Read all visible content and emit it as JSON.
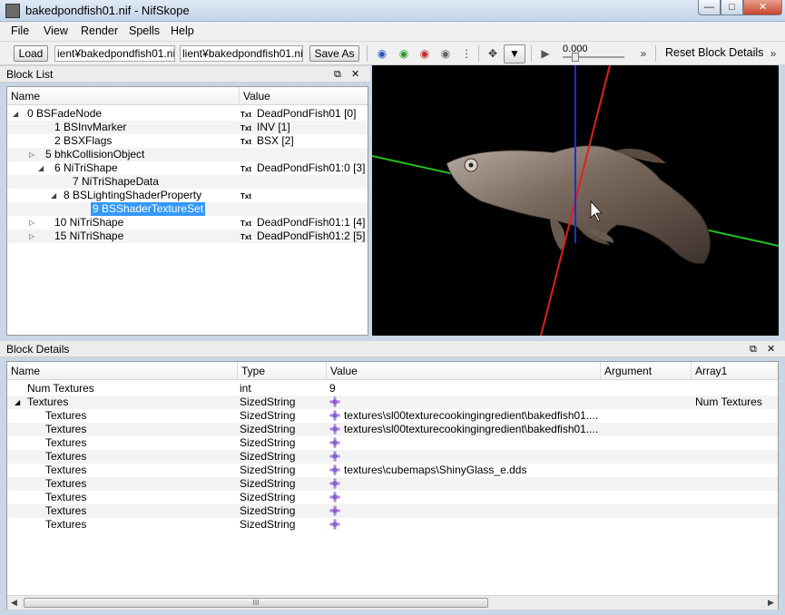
{
  "window": {
    "title": "bakedpondfish01.nif - NifSkope"
  },
  "menu": [
    "File",
    "View",
    "Render",
    "Spells",
    "Help"
  ],
  "toolbar": {
    "load_label": "Load",
    "load_path": "‎ient¥bakedpondfish01.nif",
    "save_path": "lient¥bakedpondfish01.nif",
    "save_label": "Save As",
    "time_value": "0.000",
    "reset_label": "Reset Block Details",
    "more_label": "»"
  },
  "block_list": {
    "title": "Block List",
    "columns": [
      "Name",
      "Value"
    ],
    "rows": [
      {
        "label": "0 BSFadeNode",
        "value": "DeadPondFish01 [0]",
        "expander": "open",
        "txt": true
      },
      {
        "label": "1 BSInvMarker",
        "value": "INV [1]",
        "expander": "",
        "txt": true
      },
      {
        "label": "2 BSXFlags",
        "value": "BSX [2]",
        "expander": "",
        "txt": true
      },
      {
        "label": "5 bhkCollisionObject",
        "value": "",
        "expander": "closed",
        "txt": false
      },
      {
        "label": "6 NiTriShape",
        "value": "DeadPondFish01:0 [3]",
        "expander": "open",
        "txt": true
      },
      {
        "label": "7 NiTriShapeData",
        "value": "",
        "expander": "",
        "txt": false
      },
      {
        "label": "8 BSLightingShaderProperty",
        "value": "",
        "expander": "open",
        "txt": true
      },
      {
        "label": "9 BSShaderTextureSet",
        "value": "",
        "expander": "",
        "txt": false
      },
      {
        "label": "10 NiTriShape",
        "value": "DeadPondFish01:1 [4]",
        "expander": "closed",
        "txt": true
      },
      {
        "label": "15 NiTriShape",
        "value": "DeadPondFish01:2 [5]",
        "expander": "closed",
        "txt": true
      }
    ],
    "txt_badge": "Txt"
  },
  "block_details": {
    "title": "Block Details",
    "columns": [
      "Name",
      "Type",
      "Value",
      "Argument",
      "Array1"
    ],
    "rows": [
      {
        "name": "Num Textures",
        "type": "int",
        "value": "9",
        "array1": "",
        "gem": false
      },
      {
        "name": "Textures",
        "type": "SizedString",
        "value": "",
        "array1": "Num Textures",
        "gem": true
      },
      {
        "name": "Textures",
        "type": "SizedString",
        "value": "textures\\sl00texturecookingingredient\\bakedfish01....",
        "array1": "",
        "gem": true
      },
      {
        "name": "Textures",
        "type": "SizedString",
        "value": "textures\\sl00texturecookingingredient\\bakedfish01....",
        "array1": "",
        "gem": true
      },
      {
        "name": "Textures",
        "type": "SizedString",
        "value": "",
        "array1": "",
        "gem": true
      },
      {
        "name": "Textures",
        "type": "SizedString",
        "value": "",
        "array1": "",
        "gem": true
      },
      {
        "name": "Textures",
        "type": "SizedString",
        "value": "textures\\cubemaps\\ShinyGlass_e.dds",
        "array1": "",
        "gem": true
      },
      {
        "name": "Textures",
        "type": "SizedString",
        "value": "",
        "array1": "",
        "gem": true
      },
      {
        "name": "Textures",
        "type": "SizedString",
        "value": "",
        "array1": "",
        "gem": true
      },
      {
        "name": "Textures",
        "type": "SizedString",
        "value": "",
        "array1": "",
        "gem": true
      },
      {
        "name": "Textures",
        "type": "SizedString",
        "value": "",
        "array1": "",
        "gem": true
      }
    ],
    "scroll_thumb": "III"
  },
  "colors": {
    "selection": "#3399ff",
    "viewport_bg": "#000000",
    "axis_x": "#e0201c",
    "axis_y": "#22c022",
    "axis_z": "#1b2fd6"
  }
}
